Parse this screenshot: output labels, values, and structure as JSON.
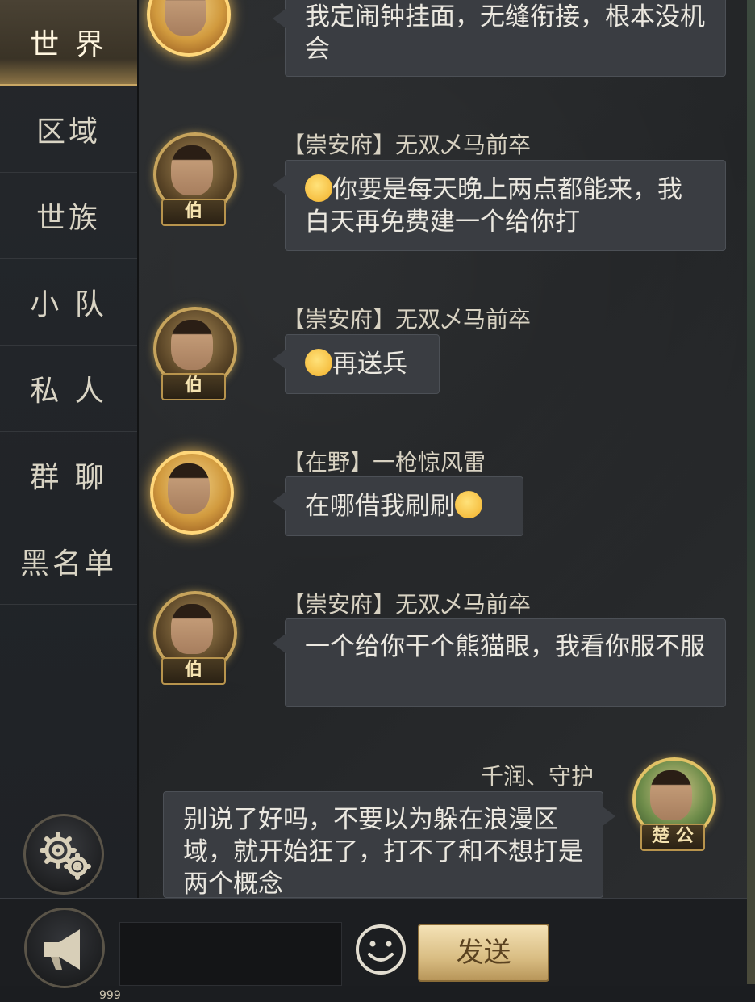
{
  "sidebar": {
    "tabs": [
      {
        "label": "世 界",
        "active": true
      },
      {
        "label": "区域",
        "active": false
      },
      {
        "label": "世族",
        "active": false
      },
      {
        "label": "小 队",
        "active": false
      },
      {
        "label": "私 人",
        "active": false
      },
      {
        "label": "群 聊",
        "active": false
      },
      {
        "label": "黑名单",
        "active": false
      }
    ],
    "settings_icon": "gear-icon"
  },
  "messages": [
    {
      "sender": "",
      "text": "我定闹钟挂面，无缝衔接，根本没机会",
      "rank": "",
      "avatar": "gold-winged"
    },
    {
      "sender": "【崇安府】无双乄马前卒",
      "text": "你要是每天晚上两点都能来，我白天再免费建一个给你打",
      "rank": "伯",
      "emoji": "smirk-face"
    },
    {
      "sender": "【崇安府】无双乄马前卒",
      "text": "再送兵",
      "rank": "伯",
      "emoji": "smirk-face"
    },
    {
      "sender": "【在野】一枪惊风雷",
      "text": "在哪借我刷刷",
      "rank": "",
      "emoji": "grin-face"
    },
    {
      "sender": "【崇安府】无双乄马前卒",
      "text": "一个给你干个熊猫眼，我看你服不服",
      "rank": "伯"
    },
    {
      "sender": "千润、守护",
      "text": "别说了好吗，不要以为躲在浪漫区域，就开始狂了，打不了和不想打是两个概念",
      "rank": "楚 公",
      "self": true
    }
  ],
  "bottom": {
    "horn_icon": "megaphone-icon",
    "horn_count": "999",
    "input_value": "",
    "emoji_icon": "smiley-icon",
    "send_label": "发送"
  },
  "colors": {
    "bubble": "#3a3d42",
    "accent_gold": "#c9a765",
    "send_button": "#d9bd83"
  }
}
